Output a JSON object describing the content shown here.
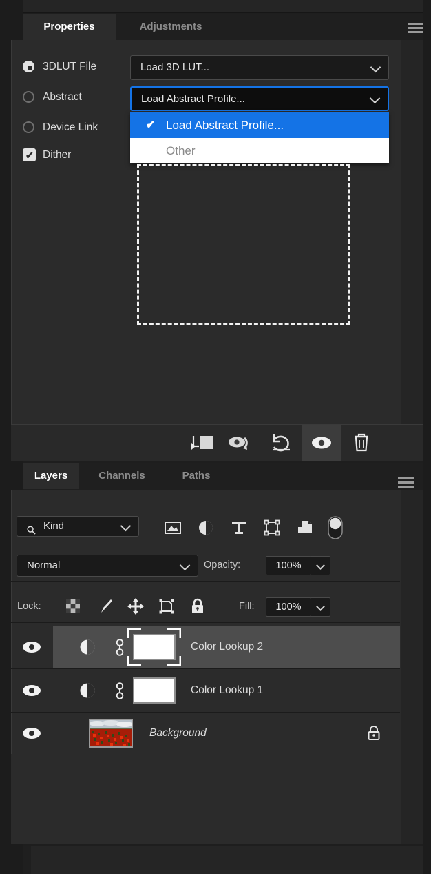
{
  "properties_panel": {
    "tabs": [
      {
        "label": "Properties",
        "active": true
      },
      {
        "label": "Adjustments",
        "active": false
      }
    ],
    "menu_icon": "hamburger-menu-icon",
    "lut_type_options": [
      {
        "label": "3DLUT File",
        "selected": true,
        "type": "radio"
      },
      {
        "label": "Abstract",
        "selected": false,
        "type": "radio"
      },
      {
        "label": "Device Link",
        "selected": false,
        "type": "radio"
      }
    ],
    "dither": {
      "label": "Dither",
      "checked": true
    },
    "lut_file_select": {
      "value": "Load 3D LUT...",
      "icon": "chevron-down-icon"
    },
    "abstract_select": {
      "value": "Load Abstract Profile...",
      "icon": "chevron-down-icon",
      "focused": true
    },
    "open_dropdown": {
      "items": [
        {
          "label": "Load Abstract Profile...",
          "checked": true
        },
        {
          "label": "Other",
          "checked": false
        }
      ],
      "check_glyph": "✔",
      "highlight_color": "#1473e6"
    },
    "dropzone": {
      "name": "lut-drop-area"
    },
    "toolbar": [
      {
        "name": "clip-to-layer-icon",
        "active": false
      },
      {
        "name": "toggle-mask-view-icon",
        "active": false
      },
      {
        "name": "reset-adjustment-icon",
        "active": false
      },
      {
        "name": "toggle-layer-visibility-icon",
        "active": true
      },
      {
        "name": "delete-adjustment-layer-icon",
        "active": false
      }
    ]
  },
  "layers_panel": {
    "tabs": [
      {
        "label": "Layers",
        "active": true
      },
      {
        "label": "Channels",
        "active": false
      },
      {
        "label": "Paths",
        "active": false
      }
    ],
    "menu_icon": "hamburger-menu-icon",
    "filter": {
      "kind_label": "Kind",
      "search_icon": "search-icon",
      "chevron": "chevron-down-icon",
      "icons": [
        {
          "name": "filter-pixel-layers-icon"
        },
        {
          "name": "filter-adjustment-layers-icon"
        },
        {
          "name": "filter-type-layers-icon"
        },
        {
          "name": "filter-shape-layers-icon"
        },
        {
          "name": "filter-smart-object-layers-icon"
        },
        {
          "name": "filter-toggle-switch"
        }
      ]
    },
    "blend": {
      "mode": "Normal",
      "opacity_label": "Opacity:",
      "opacity_value": "100%"
    },
    "lock": {
      "label": "Lock:",
      "icons": [
        {
          "name": "lock-transparent-pixels-icon"
        },
        {
          "name": "lock-image-pixels-icon"
        },
        {
          "name": "lock-position-icon"
        },
        {
          "name": "lock-artboard-nesting-icon"
        },
        {
          "name": "lock-all-icon"
        }
      ],
      "fill_label": "Fill:",
      "fill_value": "100%"
    },
    "layers": [
      {
        "name": "Color Lookup 2",
        "visible": true,
        "selected": true,
        "kind": "adjustment",
        "linked": true,
        "italic": false,
        "locked": false
      },
      {
        "name": "Color Lookup 1",
        "visible": true,
        "selected": false,
        "kind": "adjustment",
        "linked": true,
        "italic": false,
        "locked": false
      },
      {
        "name": "Background",
        "visible": true,
        "selected": false,
        "kind": "image",
        "linked": false,
        "italic": true,
        "locked": true
      }
    ]
  },
  "colors": {
    "accent": "#1473e6",
    "panel_bg": "#2b2b2b",
    "tabbar_bg": "#1f1f1f",
    "selected_row": "#4d4d4d",
    "text": "#dcdcdc"
  }
}
